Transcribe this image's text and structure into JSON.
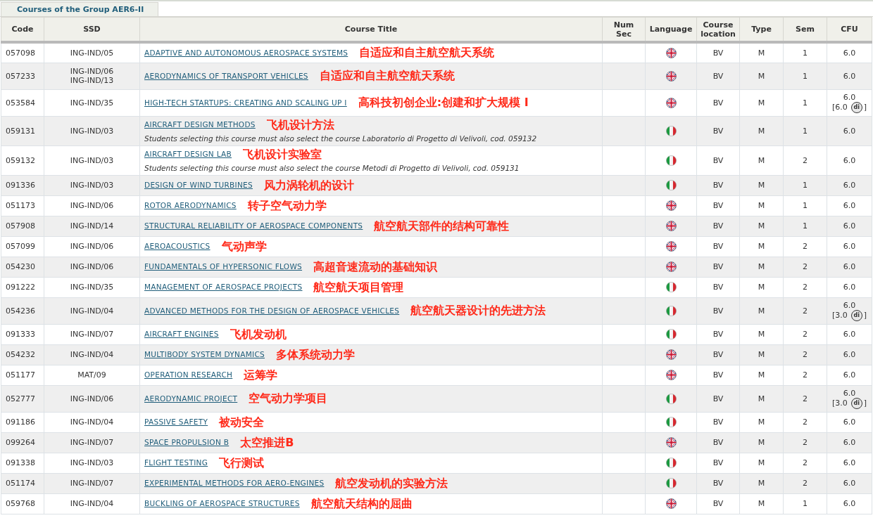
{
  "tab": {
    "label": "Courses of the Group AER6-II",
    "selected": true
  },
  "columns": [
    "Code",
    "SSD",
    "Course Title",
    "Num Sec",
    "Language",
    "Course location",
    "Type",
    "Sem",
    "CFU"
  ],
  "rows": [
    {
      "code": "057098",
      "ssd": [
        "ING-IND/05"
      ],
      "title": "ADAPTIVE AND AUTONOMOUS AEROSPACE SYSTEMS",
      "annotation": "自适应和自主航空航天系统",
      "kind": "uk",
      "location": "BV",
      "type": "M",
      "sem": "1",
      "cfu": "6.0"
    },
    {
      "code": "057233",
      "ssd": [
        "ING-IND/06",
        "ING-IND/13"
      ],
      "title": "AERODYNAMICS OF TRANSPORT VEHICLES",
      "annotation": "自适应和自主航空航天系统",
      "kind": "uk",
      "location": "BV",
      "type": "M",
      "sem": "1",
      "cfu": "6.0"
    },
    {
      "code": "053584",
      "ssd": [
        "ING-IND/35"
      ],
      "title": "HIGH-TECH STARTUPS: CREATING AND SCALING UP I",
      "annotation": "高科技初创企业:创建和扩大规模 I",
      "kind": "uk",
      "location": "BV",
      "type": "M",
      "sem": "1",
      "cfu": "6.0",
      "cfu_extra": {
        "open": "[6.0",
        "badge": "di",
        "close": "]"
      }
    },
    {
      "code": "059131",
      "ssd": [
        "ING-IND/03"
      ],
      "title": "AIRCRAFT DESIGN METHODS",
      "annotation": "飞机设计方法",
      "note": "Students selecting this course must also select the course Laboratorio di Progetto di Velivoli, cod. 059132",
      "kind": "italy",
      "location": "BV",
      "type": "M",
      "sem": "1",
      "cfu": "6.0"
    },
    {
      "code": "059132",
      "ssd": [
        "ING-IND/03"
      ],
      "title": "AIRCRAFT DESIGN LAB",
      "annotation": "飞机设计实验室",
      "note": "Students selecting this course must also select the course Metodi di Progetto di Velivoli, cod. 059131",
      "kind": "italy",
      "location": "BV",
      "type": "M",
      "sem": "2",
      "cfu": "6.0"
    },
    {
      "code": "091336",
      "ssd": [
        "ING-IND/03"
      ],
      "title": "DESIGN OF WIND TURBINES",
      "annotation": "风力涡轮机的设计",
      "kind": "italy",
      "location": "BV",
      "type": "M",
      "sem": "1",
      "cfu": "6.0"
    },
    {
      "code": "051173",
      "ssd": [
        "ING-IND/06"
      ],
      "title": "ROTOR AERODYNAMICS",
      "annotation": "转子空气动力学",
      "kind": "uk",
      "location": "BV",
      "type": "M",
      "sem": "1",
      "cfu": "6.0"
    },
    {
      "code": "057908",
      "ssd": [
        "ING-IND/14"
      ],
      "title": "STRUCTURAL RELIABILITY OF AEROSPACE COMPONENTS",
      "annotation": "航空航天部件的结构可靠性",
      "kind": "uk",
      "location": "BV",
      "type": "M",
      "sem": "1",
      "cfu": "6.0"
    },
    {
      "code": "057099",
      "ssd": [
        "ING-IND/06"
      ],
      "title": "AEROACOUSTICS",
      "annotation": "气动声学",
      "kind": "uk",
      "location": "BV",
      "type": "M",
      "sem": "2",
      "cfu": "6.0"
    },
    {
      "code": "054230",
      "ssd": [
        "ING-IND/06"
      ],
      "title": "FUNDAMENTALS OF HYPERSONIC FLOWS",
      "annotation": "高超音速流动的基础知识",
      "kind": "uk",
      "location": "BV",
      "type": "M",
      "sem": "2",
      "cfu": "6.0"
    },
    {
      "code": "091222",
      "ssd": [
        "ING-IND/35"
      ],
      "title": "MANAGEMENT OF AEROSPACE PROJECTS",
      "annotation": "航空航天项目管理",
      "kind": "italy",
      "location": "BV",
      "type": "M",
      "sem": "2",
      "cfu": "6.0"
    },
    {
      "code": "054236",
      "ssd": [
        "ING-IND/04"
      ],
      "title": "ADVANCED METHODS FOR THE DESIGN OF AEROSPACE VEHICLES",
      "annotation": "航空航天器设计的先进方法",
      "kind": "italy",
      "location": "BV",
      "type": "M",
      "sem": "2",
      "cfu": "6.0",
      "cfu_extra": {
        "open": "[3.0",
        "badge": "di",
        "close": "]"
      }
    },
    {
      "code": "091333",
      "ssd": [
        "ING-IND/07"
      ],
      "title": "AIRCRAFT ENGINES",
      "annotation": "飞机发动机",
      "kind": "italy",
      "location": "BV",
      "type": "M",
      "sem": "2",
      "cfu": "6.0"
    },
    {
      "code": "054232",
      "ssd": [
        "ING-IND/04"
      ],
      "title": "MULTIBODY SYSTEM DYNAMICS",
      "annotation": "多体系统动力学",
      "kind": "uk",
      "location": "BV",
      "type": "M",
      "sem": "2",
      "cfu": "6.0"
    },
    {
      "code": "051177",
      "ssd": [
        "MAT/09"
      ],
      "title": "OPERATION RESEARCH",
      "annotation": "运筹学",
      "kind": "uk",
      "location": "BV",
      "type": "M",
      "sem": "2",
      "cfu": "6.0"
    },
    {
      "code": "052777",
      "ssd": [
        "ING-IND/06"
      ],
      "title": "AERODYNAMIC PROJECT",
      "annotation": "空气动力学项目",
      "kind": "italy",
      "location": "BV",
      "type": "M",
      "sem": "2",
      "cfu": "6.0",
      "cfu_extra": {
        "open": "[3.0",
        "badge": "di",
        "close": "]"
      }
    },
    {
      "code": "091186",
      "ssd": [
        "ING-IND/04"
      ],
      "title": "PASSIVE SAFETY",
      "annotation": "被动安全",
      "kind": "italy",
      "location": "BV",
      "type": "M",
      "sem": "2",
      "cfu": "6.0"
    },
    {
      "code": "099264",
      "ssd": [
        "ING-IND/07"
      ],
      "title": "SPACE PROPULSION B",
      "annotation": "太空推进B",
      "kind": "uk",
      "location": "BV",
      "type": "M",
      "sem": "2",
      "cfu": "6.0"
    },
    {
      "code": "091338",
      "ssd": [
        "ING-IND/03"
      ],
      "title": "FLIGHT TESTING",
      "annotation": "飞行测试",
      "kind": "italy",
      "location": "BV",
      "type": "M",
      "sem": "2",
      "cfu": "6.0"
    },
    {
      "code": "051174",
      "ssd": [
        "ING-IND/07"
      ],
      "title": "EXPERIMENTAL METHODS FOR AERO-ENGINES",
      "annotation": "航空发动机的实验方法",
      "kind": "italy",
      "location": "BV",
      "type": "M",
      "sem": "2",
      "cfu": "6.0"
    },
    {
      "code": "059768",
      "ssd": [
        "ING-IND/04"
      ],
      "title": "BUCKLING OF AEROSPACE STRUCTURES",
      "annotation": "航空航天结构的屈曲",
      "kind": "uk",
      "location": "BV",
      "type": "M",
      "sem": "1",
      "cfu": "6.0"
    }
  ]
}
